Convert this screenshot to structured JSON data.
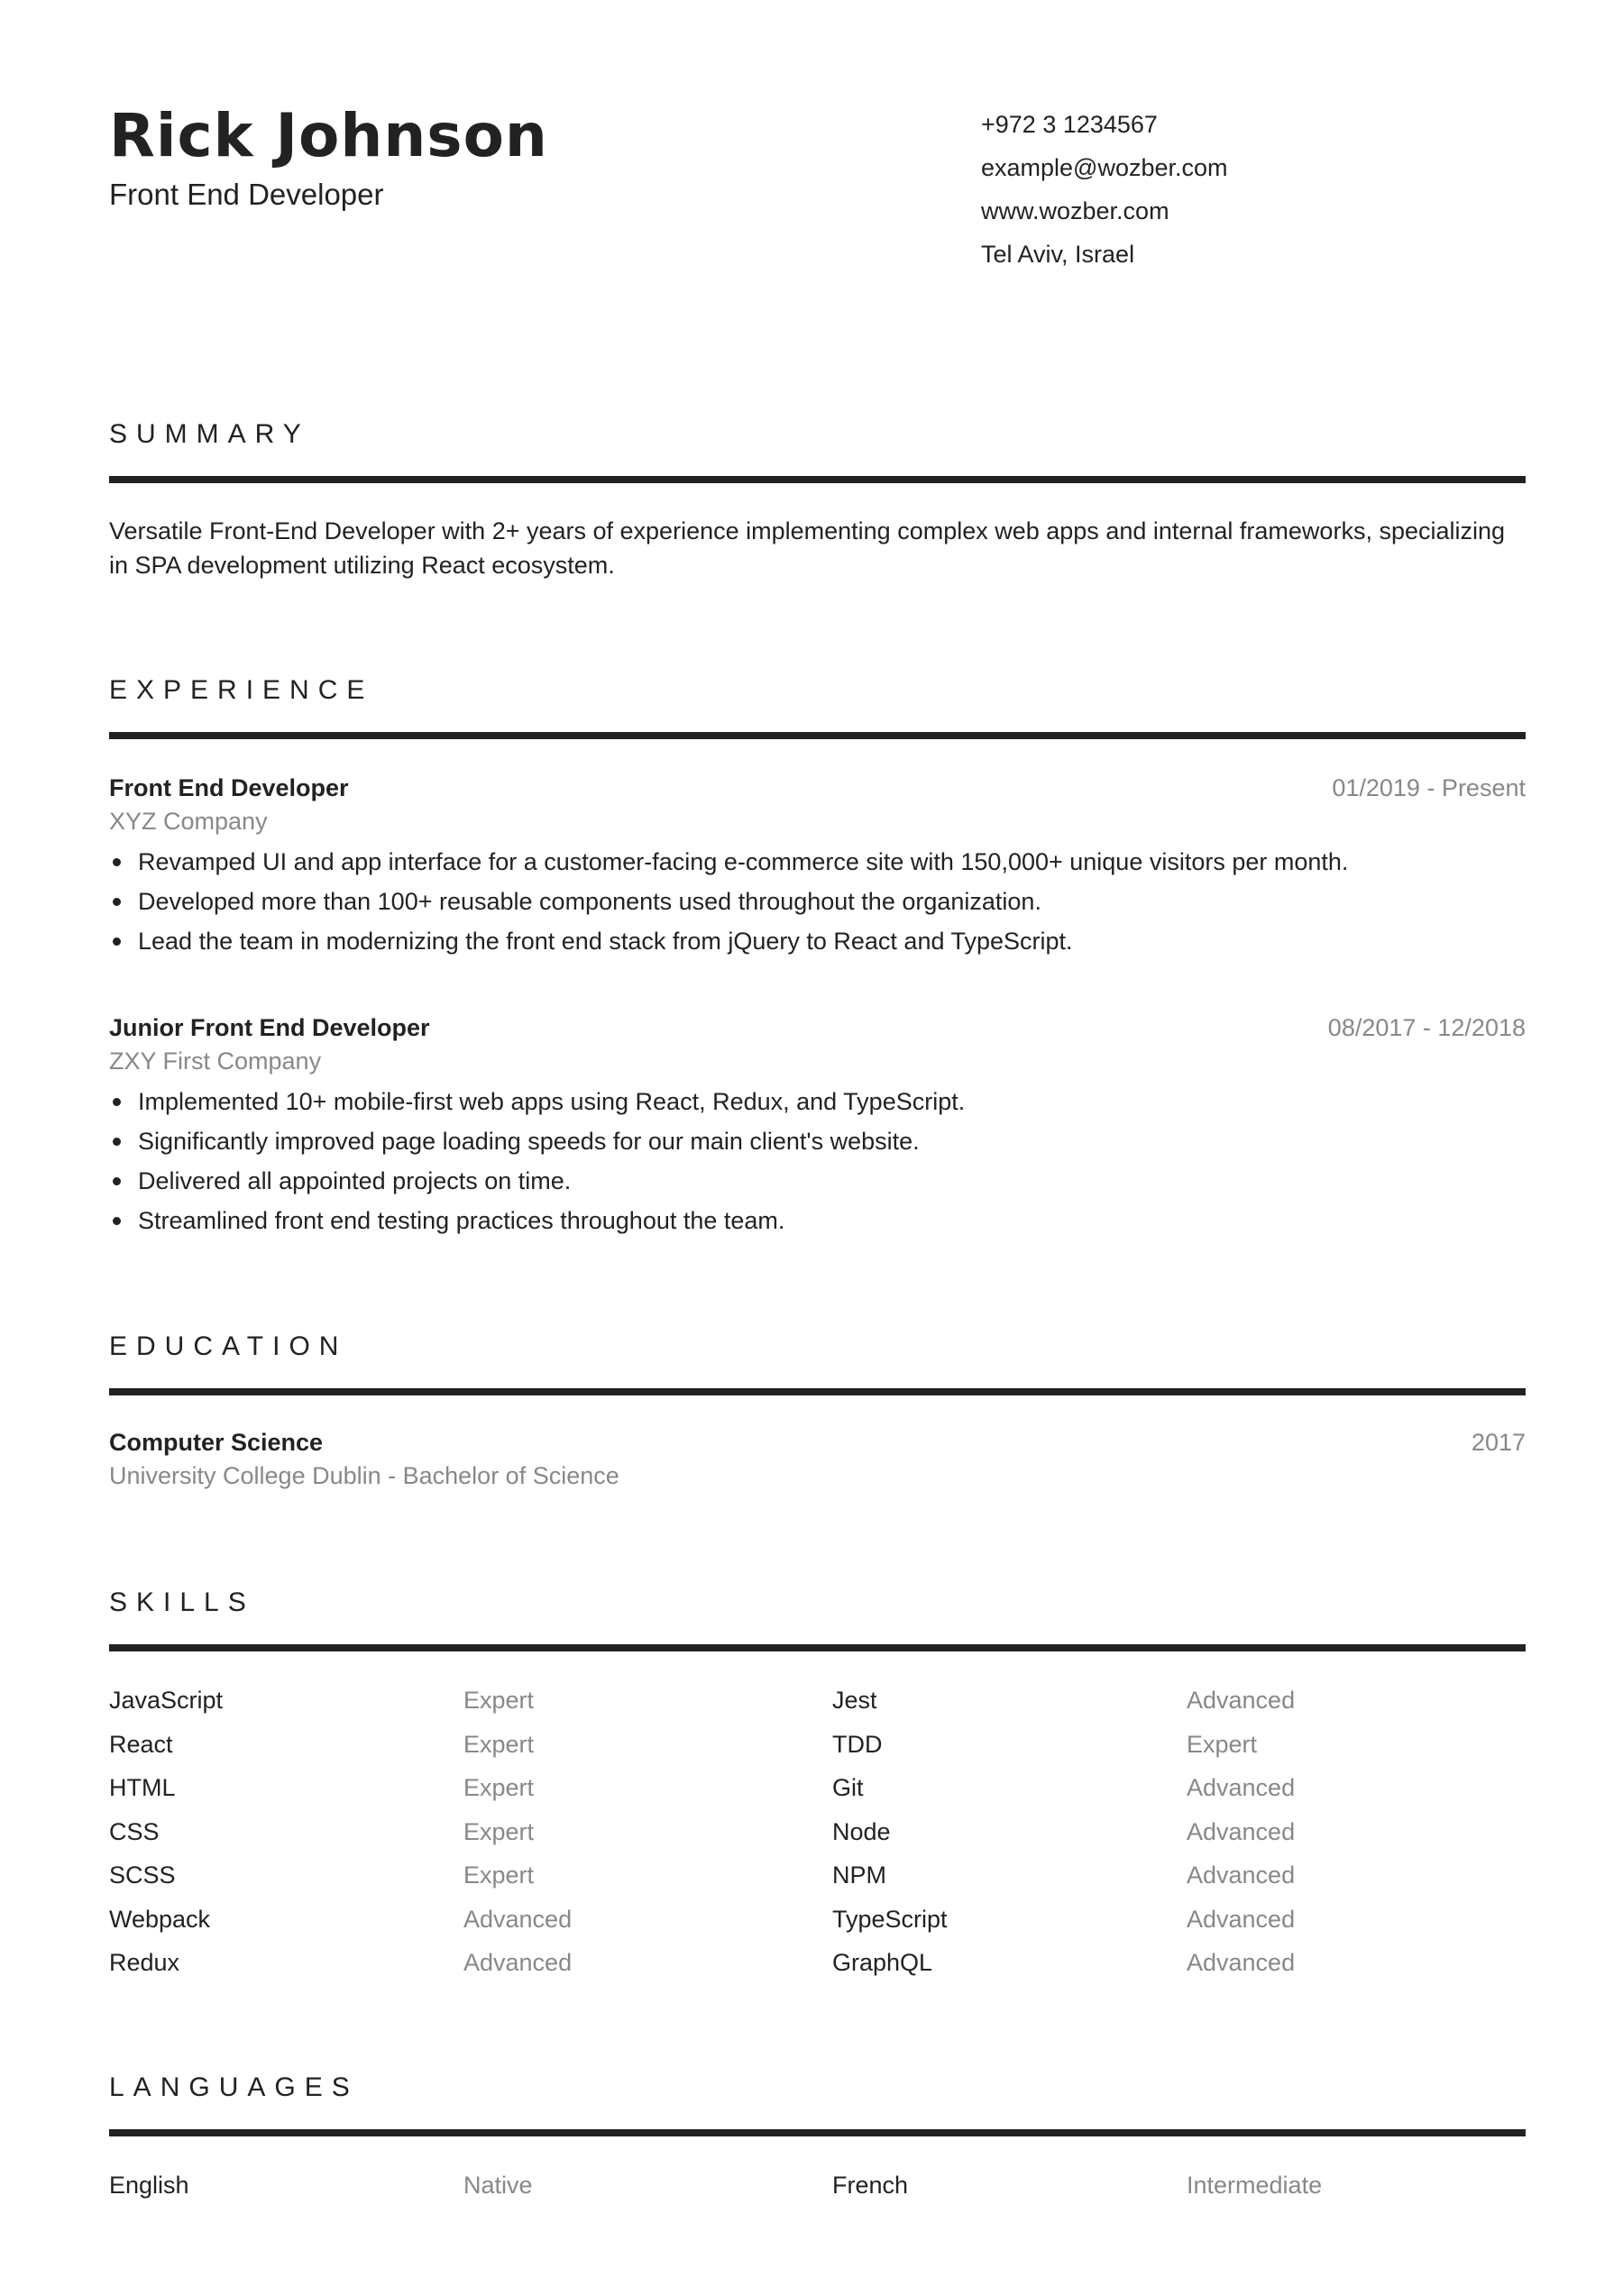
{
  "header": {
    "name": "Rick Johnson",
    "title": "Front End Developer",
    "contact": {
      "phone": "+972 3 1234567",
      "email": "example@wozber.com",
      "website": "www.wozber.com",
      "location": "Tel Aviv, Israel"
    }
  },
  "summary": {
    "heading": "SUMMARY",
    "text": "Versatile Front-End Developer with 2+ years of experience implementing complex web apps and internal frameworks, specializing in SPA development utilizing React ecosystem."
  },
  "experience": {
    "heading": "EXPERIENCE",
    "jobs": [
      {
        "title": "Front End Developer",
        "company": "XYZ Company",
        "dates": "01/2019 - Present",
        "bullets": [
          "Revamped UI and app interface for a customer-facing e-commerce site with 150,000+ unique visitors per month.",
          "Developed more than 100+ reusable components used throughout the organization.",
          "Lead the team in modernizing the front end stack from jQuery to React and TypeScript."
        ]
      },
      {
        "title": "Junior Front End Developer",
        "company": "ZXY First Company",
        "dates": "08/2017 - 12/2018",
        "bullets": [
          "Implemented 10+ mobile-first web apps using React, Redux, and TypeScript.",
          "Significantly improved page loading speeds for our main client's website.",
          "Delivered all appointed projects on time.",
          "Streamlined front end testing practices throughout the team."
        ]
      }
    ]
  },
  "education": {
    "heading": "EDUCATION",
    "items": [
      {
        "degree": "Computer Science",
        "school": "University College Dublin - Bachelor of Science",
        "year": "2017"
      }
    ]
  },
  "skills": {
    "heading": "SKILLS",
    "rows": [
      {
        "left": {
          "name": "JavaScript",
          "level": "Expert"
        },
        "right": {
          "name": "Jest",
          "level": "Advanced"
        }
      },
      {
        "left": {
          "name": "React",
          "level": "Expert"
        },
        "right": {
          "name": "TDD",
          "level": "Expert"
        }
      },
      {
        "left": {
          "name": "HTML",
          "level": "Expert"
        },
        "right": {
          "name": "Git",
          "level": "Advanced"
        }
      },
      {
        "left": {
          "name": "CSS",
          "level": "Expert"
        },
        "right": {
          "name": "Node",
          "level": "Advanced"
        }
      },
      {
        "left": {
          "name": "SCSS",
          "level": "Expert"
        },
        "right": {
          "name": "NPM",
          "level": "Advanced"
        }
      },
      {
        "left": {
          "name": "Webpack",
          "level": "Advanced"
        },
        "right": {
          "name": "TypeScript",
          "level": "Advanced"
        }
      },
      {
        "left": {
          "name": "Redux",
          "level": "Advanced"
        },
        "right": {
          "name": "GraphQL",
          "level": "Advanced"
        }
      }
    ]
  },
  "languages": {
    "heading": "LANGUAGES",
    "rows": [
      {
        "left": {
          "name": "English",
          "level": "Native"
        },
        "right": {
          "name": "French",
          "level": "Intermediate"
        }
      }
    ]
  },
  "colors": {
    "text": "#222222",
    "muted": "#888888",
    "rule": "#222222",
    "background": "#ffffff"
  }
}
